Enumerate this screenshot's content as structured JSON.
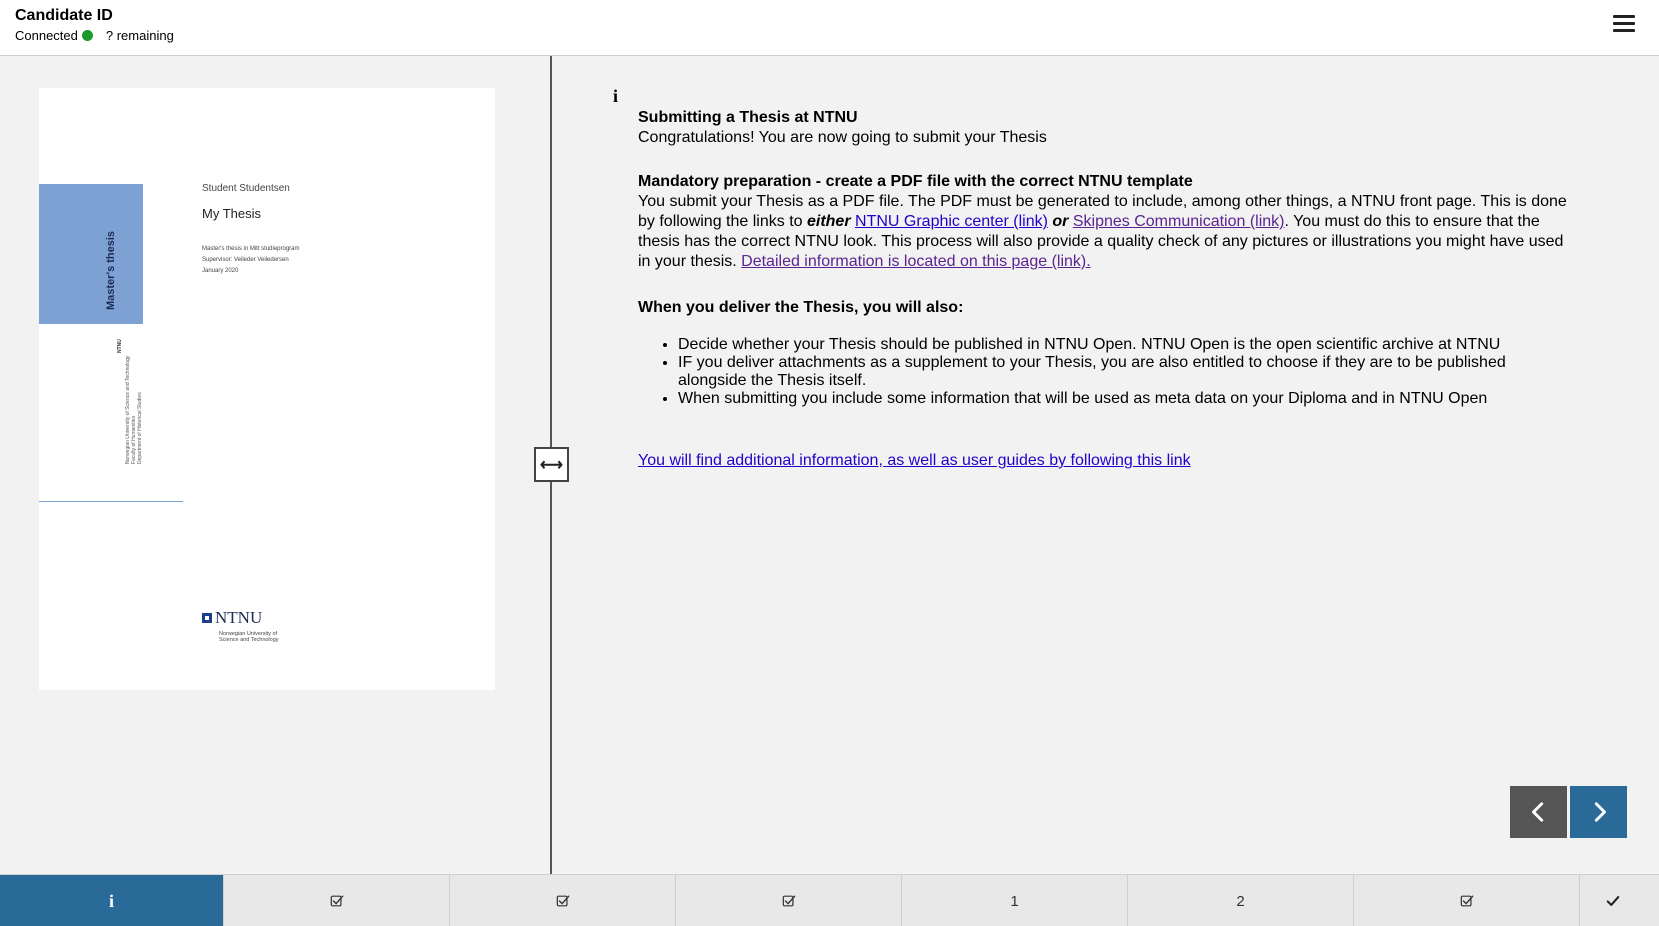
{
  "header": {
    "candidate_label": "Candidate ID",
    "status": "Connected",
    "remaining": "? remaining",
    "status_color": "#1a9a2a"
  },
  "pdf_preview": {
    "vertical_title": "Master's thesis",
    "vertical_ntnu": "NTNU",
    "vertical_lines": [
      "Norwegian University of Science and Technology",
      "Faculty of Humanities",
      "Department of Historical Studies"
    ],
    "student": "Student Studentsen",
    "title": "My Thesis",
    "meta_lines": [
      "Master's thesis in Mitt studieprogram",
      "Supervisor: Veileder Veiledersen",
      "January 2020"
    ],
    "logo_text": "NTNU",
    "logo_sub": [
      "Norwegian University of",
      "Science and Technology"
    ]
  },
  "resize_handle_glyph": "⟷",
  "content": {
    "info_glyph": "i",
    "heading": "Submitting a Thesis at NTNU",
    "intro": "Congratulations! You are now going to submit your Thesis",
    "prep_heading": "Mandatory preparation - create a PDF file with the correct NTNU template",
    "prep_text_1": "You submit your Thesis as a PDF file. The PDF must be generated to include, among other things, a NTNU front page. This is done by following the links to ",
    "prep_either": "either",
    "prep_link_1": "NTNU Graphic center (link)",
    "prep_or": "or",
    "prep_link_2": "Skipnes Communication (link)",
    "prep_text_2": ". You must do this to ensure that the thesis has the correct NTNU look. This process will also provide a quality check of any pictures or illustrations you might have used in your thesis. ",
    "prep_link_3": "Detailed information is located on this page (link).",
    "deliver_heading": "When you deliver the Thesis, you will also:",
    "deliver_items": [
      "Decide whether your Thesis should be published in NTNU Open. NTNU Open is the open scientific archive at NTNU",
      "IF you deliver attachments as a supplement to your Thesis, you are also entitled to choose if they are to be published alongside the Thesis itself.",
      "When submitting you include some information that will be used as meta data on your Diploma and in NTNU Open"
    ],
    "additional_link": "You will find additional information, as well as user guides by following this link"
  },
  "tabs": [
    {
      "label": "i",
      "icon": "info-icon",
      "active": true
    },
    {
      "label": "",
      "icon": "checkbox-checked-icon"
    },
    {
      "label": "",
      "icon": "checkbox-checked-icon"
    },
    {
      "label": "",
      "icon": "checkbox-checked-icon"
    },
    {
      "label": "1"
    },
    {
      "label": "2"
    },
    {
      "label": "",
      "icon": "checkbox-checked-icon"
    },
    {
      "label": "",
      "icon": "checkmark-icon"
    }
  ],
  "colors": {
    "accent": "#2a6a99",
    "nav_prev": "#555555",
    "link": "#2200cc",
    "visited_link": "#5b2390"
  }
}
